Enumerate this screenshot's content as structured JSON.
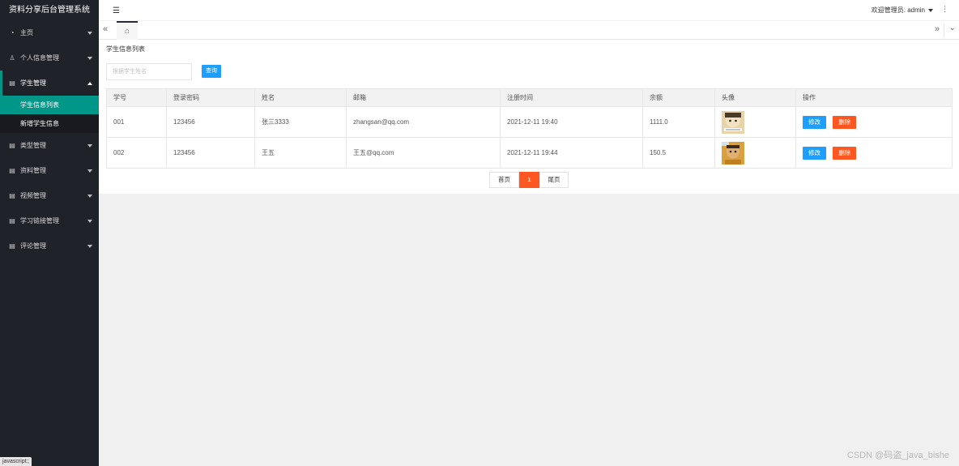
{
  "app": {
    "title": "资料分享后台管理系统"
  },
  "sidebar": {
    "items": [
      {
        "label": "主页",
        "icon": "dashboard-icon",
        "expanded": false
      },
      {
        "label": "个人信息管理",
        "icon": "user-icon",
        "expanded": false
      },
      {
        "label": "学生管理",
        "icon": "doc-icon",
        "expanded": true,
        "children": [
          {
            "label": "学生信息列表",
            "active": true
          },
          {
            "label": "新增学生信息",
            "active": false
          }
        ]
      },
      {
        "label": "类型管理",
        "icon": "doc-icon",
        "expanded": false
      },
      {
        "label": "资料管理",
        "icon": "doc-icon",
        "expanded": false
      },
      {
        "label": "视频管理",
        "icon": "doc-icon",
        "expanded": false
      },
      {
        "label": "学习链接管理",
        "icon": "doc-icon",
        "expanded": false
      },
      {
        "label": "评论管理",
        "icon": "doc-icon",
        "expanded": false
      }
    ]
  },
  "header": {
    "welcome": "欢迎管理员: admin"
  },
  "page": {
    "title": "学生信息列表",
    "search": {
      "placeholder": "根据学生姓名",
      "button": "查询"
    }
  },
  "table": {
    "columns": [
      "学号",
      "登录密码",
      "姓名",
      "邮箱",
      "注册时间",
      "余额",
      "头像",
      "操作"
    ],
    "rows": [
      {
        "id": "001",
        "password": "123456",
        "name": "张三3333",
        "email": "zhangsan@qq.com",
        "registered": "2021-12-11 19:40",
        "balance": "1111.0"
      },
      {
        "id": "002",
        "password": "123456",
        "name": "王五",
        "email": "王五@qq.com",
        "registered": "2021-12-11 19:44",
        "balance": "150.5"
      }
    ],
    "actions": {
      "edit": "修改",
      "delete": "删除"
    }
  },
  "pager": {
    "first": "首页",
    "current": "1",
    "last": "尾页"
  },
  "status": {
    "tip": "javascript:;"
  },
  "watermark": "CSDN @码盗_java_bishe",
  "colors": {
    "sidebar": "#20222a",
    "accent": "#009688",
    "primary": "#1e9fff",
    "danger": "#ff5722"
  }
}
